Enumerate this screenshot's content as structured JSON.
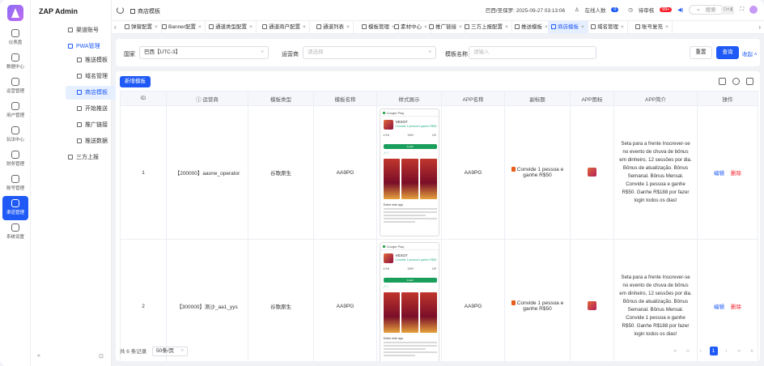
{
  "app": {
    "name": "ZAP Admin"
  },
  "rail": [
    {
      "label": "仪表盘",
      "icon": "dashboard-icon"
    },
    {
      "label": "数据中心",
      "icon": "database-icon"
    },
    {
      "label": "运营管理",
      "icon": "operations-icon"
    },
    {
      "label": "用户管理",
      "icon": "user-icon"
    },
    {
      "label": "玩法中心",
      "icon": "game-icon"
    },
    {
      "label": "财务管理",
      "icon": "finance-icon"
    },
    {
      "label": "账号管理",
      "icon": "account-icon"
    },
    {
      "label": "渠道管理",
      "icon": "channel-icon",
      "active": true
    },
    {
      "label": "系统设置",
      "icon": "settings-icon"
    }
  ],
  "menu": {
    "channel_account": "渠道账号",
    "pwa_manage": "PWA管理",
    "items": [
      "推送模板",
      "域名管理",
      "商店模板",
      "开始推送",
      "推广链接",
      "推送数据"
    ],
    "third_party": "三方上报"
  },
  "topbar": {
    "title": "商店模板",
    "datetime": "巴西/圣保罗: 2025-09-27 03:13:06",
    "online_label": "在线人数",
    "online_count": "0",
    "pending_label": "待审核",
    "pending_count": "99+",
    "search_placeholder": "搜索",
    "search_kbd": "Ctrl k"
  },
  "tabs": [
    "弹窗配置",
    "Banner配置",
    "通道类型配置",
    "通道商户配置",
    "通道列表",
    "模板管理",
    "素材中心",
    "推广链接",
    "三方上报配置",
    "推送模板",
    "商店模板",
    "域名管理",
    "账号复充"
  ],
  "active_tab": "商店模板",
  "filter": {
    "country_label": "国家",
    "country_value": "巴西【UTC-3】",
    "operator_label": "运营商",
    "operator_placeholder": "请选择",
    "template_name_label": "模板名称",
    "template_name_placeholder": "请输入",
    "reset": "重置",
    "query": "查询",
    "collapse": "收起"
  },
  "table": {
    "add_button": "新增模板",
    "headers": [
      "ID",
      "运营商",
      "模板类型",
      "模板名称",
      "样式展示",
      "APP名称",
      "副标题",
      "APP图标",
      "APP简介",
      "操作"
    ],
    "rows": [
      {
        "id": "1",
        "operator": "【200000】aaone_operator",
        "type": "谷歌原生",
        "name": "AA9PG",
        "app_name": "AA9PG",
        "subtitle": "Convide 1 pessoa e ganhe R$50",
        "intro": "Seta para a frente Inscrever-se no evento de chuva de bônus em dinheiro, 12 sessões por dia. Bônus de atualização. Bônus Semanal. Bônus Mensal. Convide 1 pessoa e ganhe R$50. Ganhe R$188 por fazer login todos os dias!"
      },
      {
        "id": "2",
        "operator": "【300000】测沙_aa1_yys",
        "type": "谷歌原生",
        "name": "AA9PG",
        "app_name": "AA9PG",
        "subtitle": "Convide 1 pessoa e ganhe R$50",
        "intro": "Seta para a frente Inscrever-se no evento de chuva de bônus em dinheiro, 12 sessões por dia. Bônus de atualização. Bônus Semanal. Bônus Mensal. Convide 1 pessoa e ganhe R$50. Ganhe R$188 por fazer login todos os dias!"
      }
    ],
    "edit": "编辑",
    "delete": "删除"
  },
  "preview": {
    "store": "Google Play",
    "app_title": "VEXO7",
    "app_tagline": "Convide 1 pessoa e ganhe R$50",
    "stats": [
      "4.9★",
      "10M+",
      "18+"
    ],
    "install": "Install",
    "about": "Sobre este app"
  },
  "footer": {
    "total": "共 6 条记录",
    "page_size": "50条/页",
    "current_page": "1"
  },
  "colors": {
    "accent": "#1f5af6",
    "danger": "#f5222d"
  }
}
